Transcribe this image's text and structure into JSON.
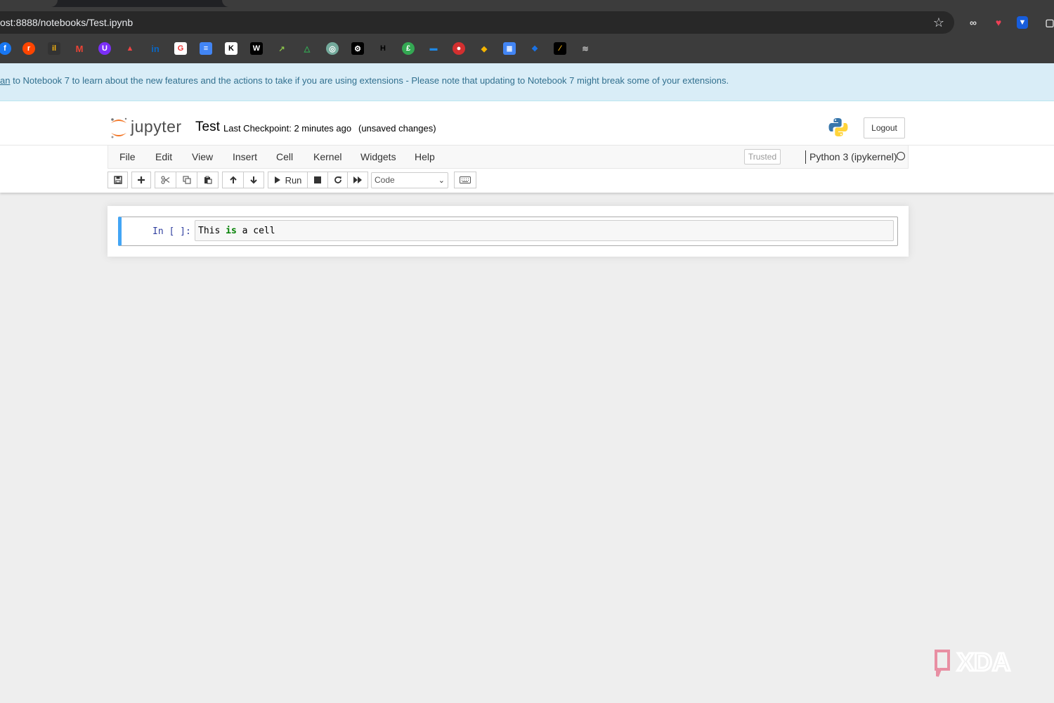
{
  "browser": {
    "url": "ost:8888/notebooks/Test.ipynb",
    "bookmarks": [
      "f",
      "r",
      "il",
      "M",
      "U",
      "▲",
      "in",
      "G",
      "≡",
      "K",
      "W",
      "↗",
      "△",
      "◎",
      "⚙",
      "H",
      "£",
      "▬",
      "●",
      "◆",
      "≣",
      "❖",
      "⁄",
      "≋"
    ]
  },
  "banner": {
    "link_text": "an",
    "text": " to Notebook 7 to learn about the new features and the actions to take if you are using extensions - Please note that updating to Notebook 7 might break some of your extensions."
  },
  "header": {
    "logo_text": "jupyter",
    "notebook_title": "Test",
    "checkpoint": "Last Checkpoint: 2 minutes ago",
    "autosave_status": "(unsaved changes)",
    "logout_label": "Logout"
  },
  "menu": {
    "items": [
      "File",
      "Edit",
      "View",
      "Insert",
      "Cell",
      "Kernel",
      "Widgets",
      "Help"
    ],
    "trusted_label": "Trusted",
    "kernel_name": "Python 3 (ipykernel)"
  },
  "toolbar": {
    "run_label": "Run",
    "cell_type": "Code"
  },
  "cell": {
    "prompt": "In [ ]:",
    "code_word1": "This ",
    "code_keyword": "is",
    "code_rest": " a cell"
  },
  "watermark": {
    "text": "XDA"
  },
  "colors": {
    "banner_bg": "#d9edf7",
    "cell_accent": "#42a5f5",
    "jupyter_orange": "#f37626"
  }
}
